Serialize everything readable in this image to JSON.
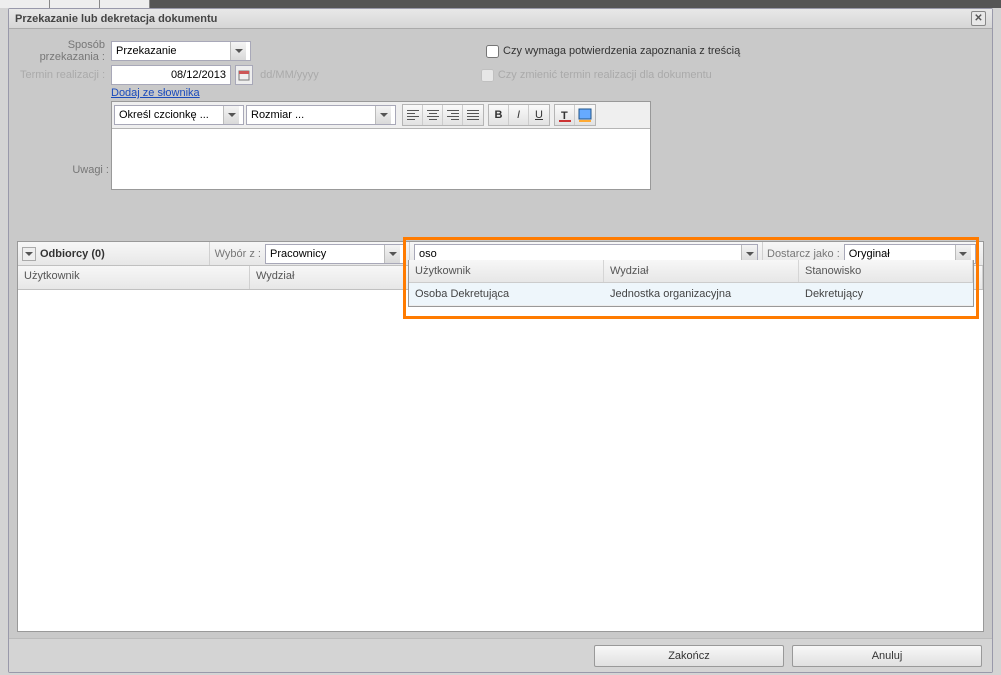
{
  "dialog": {
    "title": "Przekazanie lub dekretacja dokumentu"
  },
  "form": {
    "sposob_label": "Sposób przekazania :",
    "sposob_value": "Przekazanie",
    "termin_label": "Termin realizacji :",
    "termin_value": "08/12/2013",
    "termin_format": "dd/MM/yyyy",
    "uwagi_label": "Uwagi :",
    "dodaj_link": "Dodaj ze słownika",
    "font_placeholder": "Określ czcionkę ...",
    "size_placeholder": "Rozmiar ...",
    "check1_label": "Czy wymaga potwierdzenia zapoznania z treścią",
    "check2_label": "Czy zmienić termin realizacji dla dokumentu"
  },
  "toolbar": {
    "bold": "B",
    "italic": "I",
    "underline": "U"
  },
  "grid": {
    "odbiorcy_label": "Odbiorcy",
    "odbiorcy_count": "(0)",
    "wybor_label": "Wybór z :",
    "wybor_value": "Pracownicy",
    "search_value": "oso",
    "dostarcz_label": "Dostarcz jako :",
    "dostarcz_value": "Oryginał",
    "col_uzytkownik": "Użytkownik",
    "col_wydzial": "Wydział"
  },
  "dropdown": {
    "head_uzytkownik": "Użytkownik",
    "head_wydzial": "Wydział",
    "head_stanowisko": "Stanowisko",
    "rows": [
      {
        "uzytkownik": "Osoba Dekretująca",
        "wydzial": "Jednostka organizacyjna",
        "stanowisko": "Dekretujący"
      }
    ]
  },
  "footer": {
    "zakoncz": "Zakończ",
    "anuluj": "Anuluj"
  },
  "colors": {
    "highlight": "#ff7b00",
    "link": "#1a4bbc"
  }
}
